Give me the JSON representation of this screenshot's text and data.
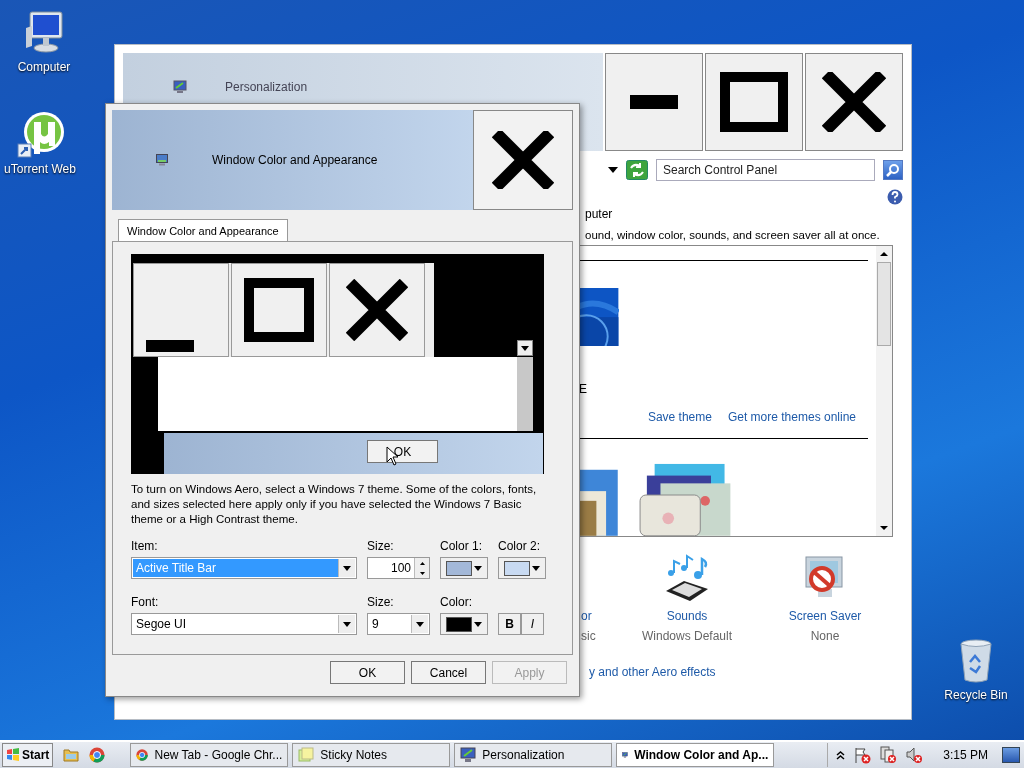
{
  "desktop_icons": [
    {
      "label": "Computer",
      "kind": "computer"
    },
    {
      "label": "uTorrent Web",
      "kind": "utorrent"
    },
    {
      "label": "Recycle Bin",
      "kind": "recycle"
    }
  ],
  "personalization": {
    "title": "Personalization",
    "search": {
      "placeholder": "Search Control Panel"
    },
    "heading": "puter",
    "description": "ound, window color, sounds, and screen saver all at once.",
    "theme_name": "E",
    "links": [
      "Save theme",
      "Get more themes online"
    ],
    "settings": [
      {
        "label": "or",
        "value": "sic"
      },
      {
        "label": "Sounds",
        "value": "Windows Default",
        "kind": "sounds"
      },
      {
        "label": "Screen Saver",
        "value": "None",
        "kind": "screensaver"
      }
    ],
    "aero_link": "y and other Aero effects"
  },
  "dialog": {
    "title": "Window Color and Appearance",
    "tabs": [
      {
        "label": "Window Color and Appearance",
        "selected": true
      }
    ],
    "preview": {
      "button": "OK"
    },
    "note": "To turn on Windows Aero, select a Windows 7 theme.  Some of the colors, fonts, and sizes selected here apply only if you have selected the Windows 7 Basic theme or a High Contrast theme.",
    "item": {
      "label": "Item:",
      "value": "Active Title Bar",
      "size_label": "Size:",
      "size": "100",
      "colors": [
        {
          "label": "Color 1:",
          "color": "#a3b8d8"
        },
        {
          "label": "Color 2:",
          "color": "#c8daf2"
        }
      ]
    },
    "font": {
      "label": "Font:",
      "value": "Segoe UI",
      "size_label": "Size:",
      "size": "9",
      "color_label": "Color:",
      "color": "#000000",
      "bold": "B",
      "italic": "I"
    },
    "buttons": [
      {
        "label": "OK",
        "disabled": false
      },
      {
        "label": "Cancel",
        "disabled": false
      },
      {
        "label": "Apply",
        "disabled": true
      }
    ]
  },
  "taskbar": {
    "start": "Start",
    "tasks": [
      {
        "label": "New Tab - Google Chr...",
        "kind": "chrome",
        "selected": false
      },
      {
        "label": "Sticky Notes",
        "kind": "notes",
        "selected": false
      },
      {
        "label": "Personalization",
        "kind": "monitor",
        "selected": false
      },
      {
        "label": "Window Color and Ap...",
        "kind": "monitor",
        "selected": true
      }
    ],
    "clock": "3:15 PM"
  }
}
